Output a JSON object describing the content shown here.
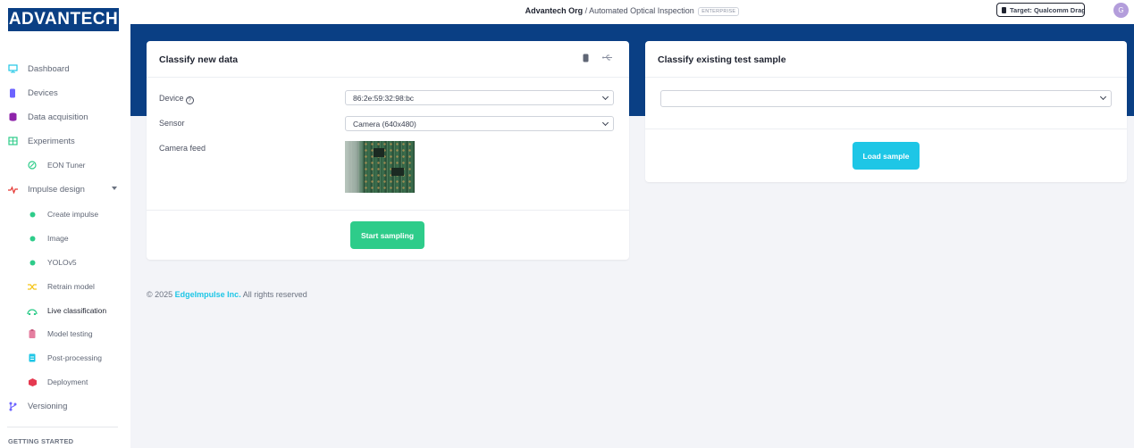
{
  "brand": {
    "logo_text": "ADVANTECH"
  },
  "sidebar": {
    "items": [
      {
        "label": "Dashboard",
        "icon": "monitor-icon",
        "color": "#1ec6e6"
      },
      {
        "label": "Devices",
        "icon": "chip-icon",
        "color": "#6c63ff"
      },
      {
        "label": "Data acquisition",
        "icon": "database-icon",
        "color": "#8e24aa"
      },
      {
        "label": "Experiments",
        "icon": "table-icon",
        "color": "#2ecc8a"
      },
      {
        "label": "EON Tuner",
        "icon": "target-icon",
        "color": "#2ecc8a"
      },
      {
        "label": "Impulse design",
        "icon": "pulse-icon",
        "color": "#e53935"
      },
      {
        "label": "Create impulse",
        "icon": "dot-icon",
        "color": "#2ecc8a"
      },
      {
        "label": "Image",
        "icon": "dot-icon",
        "color": "#2ecc8a"
      },
      {
        "label": "YOLOv5",
        "icon": "dot-icon",
        "color": "#2ecc8a"
      },
      {
        "label": "Retrain model",
        "icon": "shuffle-icon",
        "color": "#f5c518"
      },
      {
        "label": "Live classification",
        "icon": "signal-icon",
        "color": "#2ecc8a"
      },
      {
        "label": "Model testing",
        "icon": "clipboard-icon",
        "color": "#e57fa0"
      },
      {
        "label": "Post-processing",
        "icon": "document-icon",
        "color": "#1ec6e6"
      },
      {
        "label": "Deployment",
        "icon": "box-icon",
        "color": "#e53950"
      },
      {
        "label": "Versioning",
        "icon": "branch-icon",
        "color": "#6c63ff"
      }
    ],
    "section_heading": "GETTING STARTED"
  },
  "topbar": {
    "org": "Advantech Org",
    "separator": "/",
    "project": "Automated Optical Inspection",
    "badge": "ENTERPRISE",
    "target_label": "Target: Qualcomm Drago...",
    "avatar_initial": "G"
  },
  "classify_new": {
    "title": "Classify new data",
    "device_label": "Device",
    "device_value": "86:2e:59:32:98:bc",
    "sensor_label": "Sensor",
    "sensor_value": "Camera (640x480)",
    "camera_label": "Camera feed",
    "start_button": "Start sampling"
  },
  "classify_existing": {
    "title": "Classify existing test sample",
    "sample_value": "",
    "load_button": "Load sample"
  },
  "footer": {
    "copyright": "© 2025",
    "company": "EdgeImpulse Inc.",
    "rights": "All rights reserved"
  },
  "colors": {
    "brand_blue": "#0a3f84",
    "accent_green": "#2ecc8a",
    "accent_cyan": "#1ec6e6"
  }
}
